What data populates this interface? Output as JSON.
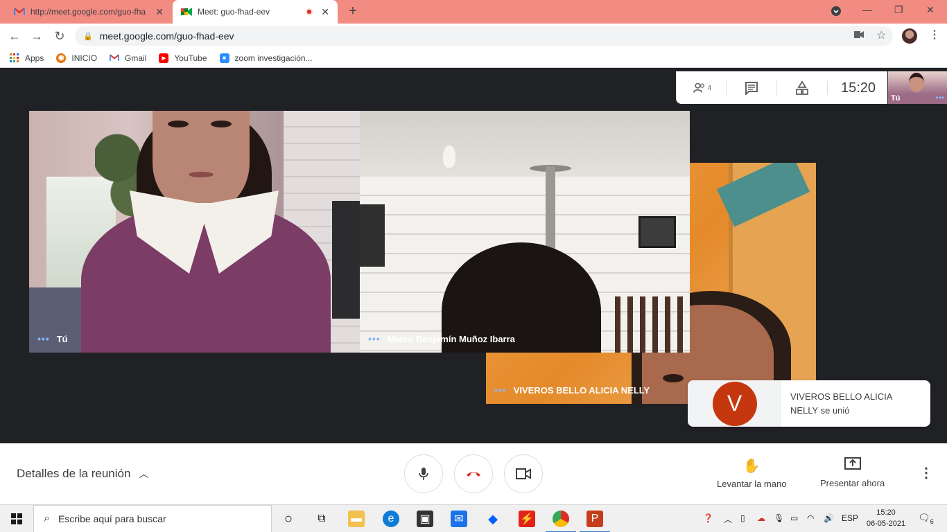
{
  "browser": {
    "tabs": [
      {
        "title": "http://meet.google.com/guo-fha",
        "close": "✕"
      },
      {
        "title": "Meet: guo-fhad-eev",
        "close": "✕"
      }
    ],
    "new_tab": "+",
    "window_controls": {
      "minimize": "—",
      "maximize": "❐",
      "close": "✕"
    },
    "url": "meet.google.com/guo-fhad-eev",
    "bookmarks": [
      {
        "label": "Apps",
        "icon": "apps-grid-icon"
      },
      {
        "label": "INICIO",
        "icon": "inicio-icon"
      },
      {
        "label": "Gmail",
        "icon": "gmail-icon"
      },
      {
        "label": "YouTube",
        "icon": "youtube-icon"
      },
      {
        "label": "zoom investigación...",
        "icon": "zoom-icon"
      }
    ]
  },
  "meet": {
    "topbar": {
      "participants_count": "4",
      "time": "15:20"
    },
    "self_thumb_label": "Tú",
    "participants": [
      {
        "name": "Tú"
      },
      {
        "name": "Mateo Benjamín Muñoz Ibarra"
      },
      {
        "name": "VIVEROS BELLO ALICIA NELLY"
      }
    ],
    "toast": {
      "avatar_letter": "V",
      "message": "VIVEROS BELLO ALICIA NELLY se unió"
    },
    "bottom": {
      "details": "Detalles de la reunión",
      "raise_hand": "Levantar la mano",
      "present": "Presentar ahora"
    }
  },
  "taskbar": {
    "search_placeholder": "Escribe aquí para buscar",
    "language": "ESP",
    "time": "15:20",
    "date": "06-05-2021",
    "notifications": "6"
  },
  "colors": {
    "tab_strip": "#f28b82",
    "meet_bg": "#202124",
    "end_call": "#d93025",
    "avatar": "#c5370e"
  }
}
